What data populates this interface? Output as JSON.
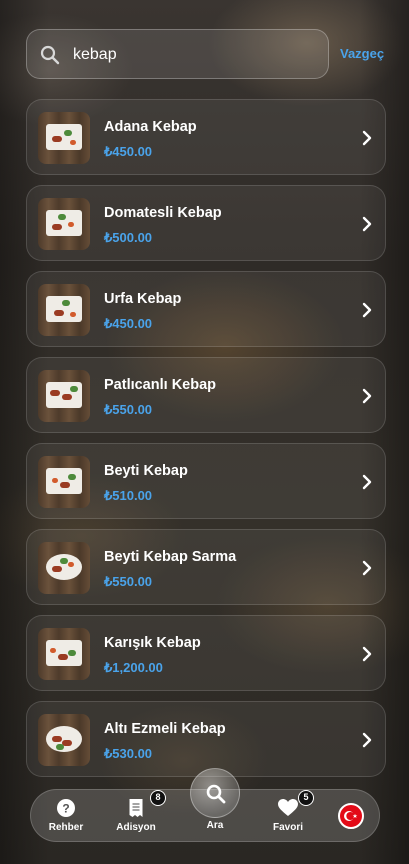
{
  "search": {
    "value": "kebap",
    "cancel_label": "Vazgeç"
  },
  "items": [
    {
      "name": "Adana Kebap",
      "price": "₺450.00"
    },
    {
      "name": "Domatesli Kebap",
      "price": "₺500.00"
    },
    {
      "name": "Urfa Kebap",
      "price": "₺450.00"
    },
    {
      "name": "Patlıcanlı Kebap",
      "price": "₺550.00"
    },
    {
      "name": "Beyti Kebap",
      "price": "₺510.00"
    },
    {
      "name": "Beyti Kebap Sarma",
      "price": "₺550.00"
    },
    {
      "name": "Karışık Kebap",
      "price": "₺1,200.00"
    },
    {
      "name": "Altı Ezmeli Kebap",
      "price": "₺530.00"
    }
  ],
  "nav": {
    "guide": "Rehber",
    "bill": "Adisyon",
    "bill_badge": "8",
    "search": "Ara",
    "favorites": "Favori",
    "favorites_badge": "5",
    "language_icon": "turkey-flag-icon"
  },
  "colors": {
    "accent": "#4aa3ea",
    "flag_red": "#e30a17"
  }
}
